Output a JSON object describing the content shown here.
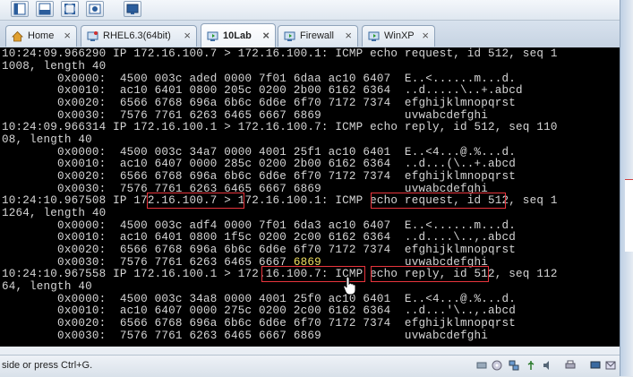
{
  "tabs": [
    {
      "label": "Home",
      "icon": "home-icon",
      "closable": true
    },
    {
      "label": "RHEL6.3(64bit)",
      "icon": "vm-icon",
      "closable": true
    },
    {
      "label": "10Lab",
      "icon": "vm-icon",
      "closable": true,
      "active": true
    },
    {
      "label": "Firewall",
      "icon": "vm-icon",
      "closable": true
    },
    {
      "label": "WinXP",
      "icon": "vm-icon",
      "closable": true
    }
  ],
  "terminal": {
    "lines": [
      "10:24:09.966290 IP 172.16.100.7 > 172.16.100.1: ICMP echo request, id 512, seq 1",
      "1008, length 40",
      "        0x0000:  4500 003c aded 0000 7f01 6daa ac10 6407  E..<......m...d.",
      "        0x0010:  ac10 6401 0800 205c 0200 2b00 6162 6364  ..d.....\\..+.abcd",
      "        0x0020:  6566 6768 696a 6b6c 6d6e 6f70 7172 7374  efghijklmnopqrst",
      "        0x0030:  7576 7761 6263 6465 6667 6869            uvwabcdefghi",
      "10:24:09.966314 IP 172.16.100.1 > 172.16.100.7: ICMP echo reply, id 512, seq 110",
      "08, length 40",
      "        0x0000:  4500 003c 34a7 0000 4001 25f1 ac10 6401  E..<4...@.%...d.",
      "        0x0010:  ac10 6407 0000 285c 0200 2b00 6162 6364  ..d...(\\..+.abcd",
      "        0x0020:  6566 6768 696a 6b6c 6d6e 6f70 7172 7374  efghijklmnopqrst",
      "        0x0030:  7576 7761 6263 6465 6667 6869            uvwabcdefghi",
      "10:24:10.967508 IP 172.16.100.7 > 172.16.100.1: ICMP echo request, id 512, seq 1",
      "1264, length 40",
      "        0x0000:  4500 003c adf4 0000 7f01 6da3 ac10 6407  E..<......m...d.",
      "        0x0010:  ac10 6401 0800 1f5c 0200 2c00 6162 6364  ..d....\\..,.abcd",
      "        0x0020:  6566 6768 696a 6b6c 6d6e 6f70 7172 7374  efghijklmnopqrst",
      "        0x0030:  7576 7761 6263 6465 6667 6869            uvwabcdefghi",
      "10:24:10.967558 IP 172.16.100.1 > 172.16.100.7: ICMP echo reply, id 512, seq 112",
      "64, length 40",
      "        0x0000:  4500 003c 34a8 0000 4001 25f0 ac10 6401  E..<4...@.%...d.",
      "        0x0010:  ac10 6407 0000 275c 0200 2c00 6162 6364  ..d...'\\..,.abcd",
      "        0x0020:  6566 6768 696a 6b6c 6d6e 6f70 7172 7374  efghijklmnopqrst",
      "        0x0030:  7576 7761 6263 6465 6667 6869            uvwabcdefghi"
    ]
  },
  "statusbar": {
    "text": "side or press Ctrl+G."
  },
  "colors": {
    "terminal_bg": "#000000",
    "terminal_fg": "#d6d6d6",
    "highlight_border": "#e8343c"
  }
}
